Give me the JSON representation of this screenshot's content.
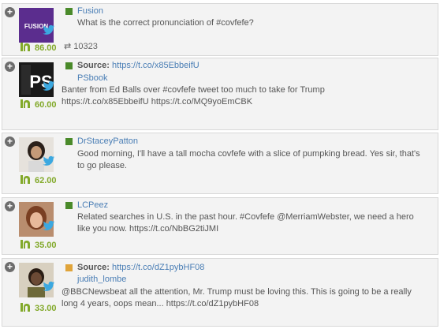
{
  "source_label": "Source:",
  "score_icon": "klout-k-icon",
  "tweets": [
    {
      "name": "Fusion",
      "text": "What is the correct pronunciation of #covfefe?",
      "retweets": "10323",
      "score": "86.00",
      "square_color": "#4a8a2a"
    },
    {
      "source_url": "https://t.co/x85EbbeifU",
      "name": "PSbook",
      "text": "Banter from Ed Balls over #covfefe tweet too much to take for Trump https://t.co/x85EbbeifU https://t.co/MQ9yoEmCBK",
      "score": "60.00",
      "square_color": "#4a8a2a"
    },
    {
      "name": "DrStaceyPatton",
      "text": "Good morning, I'll have a tall mocha covfefe with a slice of pumpking bread. Yes sir, that's to go please.",
      "score": "62.00",
      "square_color": "#4a8a2a"
    },
    {
      "name": "LCPeez",
      "text": "Related searches in U.S. in the past hour. #Covfefe @MerriamWebster, we need a hero like you now. https://t.co/NbBG2tiJMI",
      "score": "35.00",
      "square_color": "#4a8a2a"
    },
    {
      "source_url": "https://t.co/dZ1pybHF08",
      "name": "judith_lombe",
      "text": "@BBCNewsbeat all the attention, Mr. Trump must be loving this. This is going to be a really long 4 years, oops mean... https://t.co/dZ1pybHF08",
      "score": "33.00",
      "square_color": "#e0a43a"
    }
  ]
}
